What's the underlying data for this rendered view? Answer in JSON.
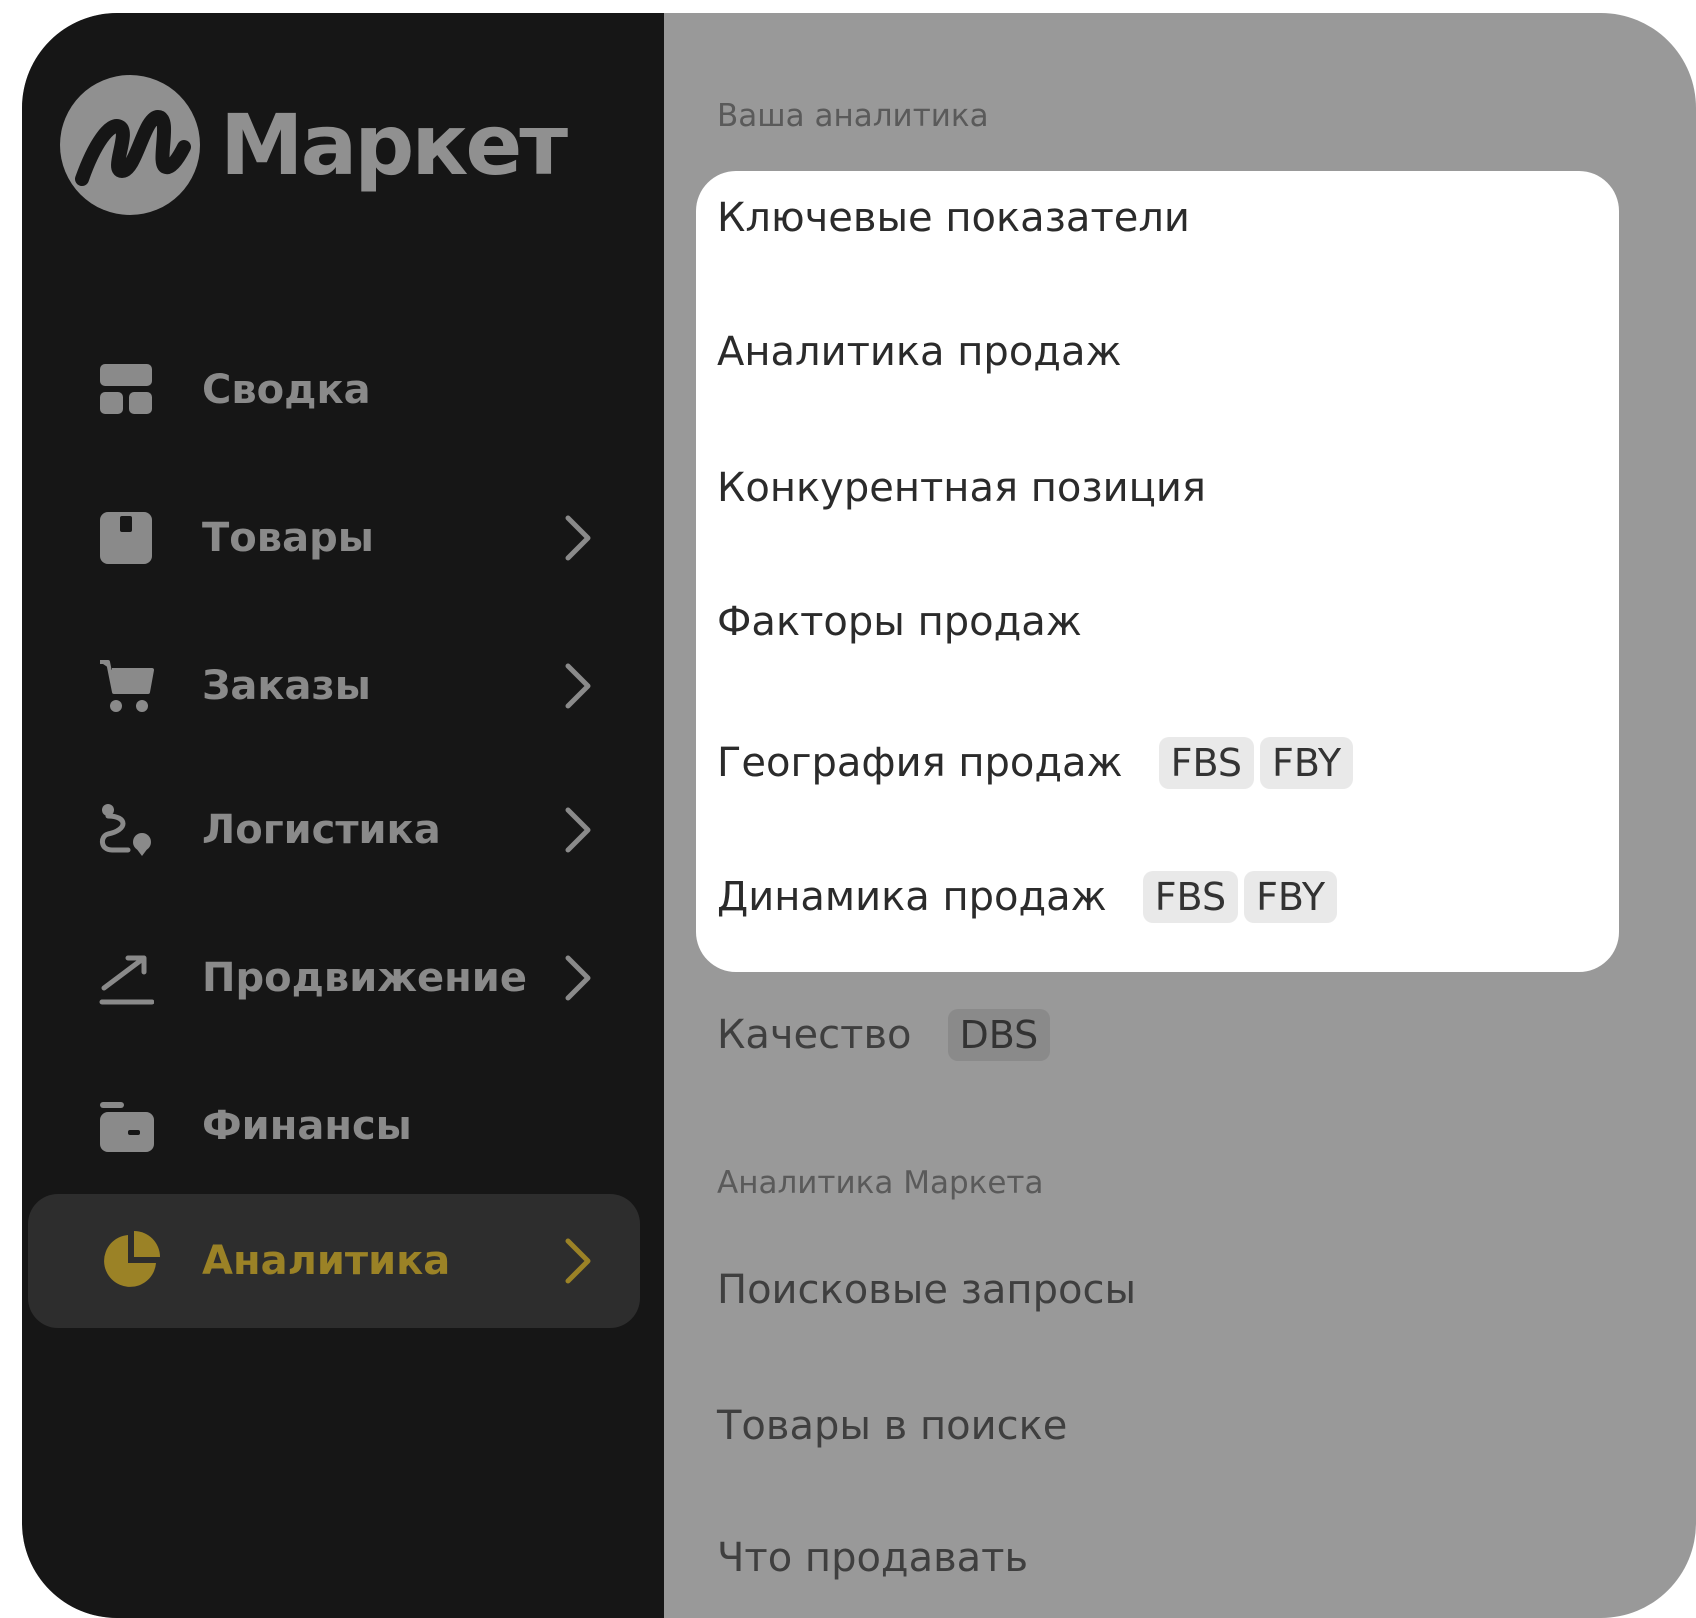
{
  "brand": {
    "name": "Маркет"
  },
  "sidebar": {
    "items": [
      {
        "label": "Сводка",
        "icon": "dashboard-icon",
        "has_chevron": false
      },
      {
        "label": "Товары",
        "icon": "box-icon",
        "has_chevron": true
      },
      {
        "label": "Заказы",
        "icon": "cart-icon",
        "has_chevron": true
      },
      {
        "label": "Логистика",
        "icon": "route-icon",
        "has_chevron": true
      },
      {
        "label": "Продвижение",
        "icon": "trend-up-icon",
        "has_chevron": true
      },
      {
        "label": "Финансы",
        "icon": "wallet-icon",
        "has_chevron": false
      },
      {
        "label": "Аналитика",
        "icon": "pie-chart-icon",
        "has_chevron": true,
        "active": true
      }
    ]
  },
  "submenu": {
    "section_your": "Ваша аналитика",
    "items": [
      {
        "label": "Ключевые показатели"
      },
      {
        "label": "Аналитика продаж"
      },
      {
        "label": "Конкурентная позиция"
      },
      {
        "label": "Факторы продаж"
      },
      {
        "label": "География продаж",
        "badges": [
          "FBS",
          "FBY"
        ]
      },
      {
        "label": "Динамика продаж",
        "badges": [
          "FBS",
          "FBY"
        ]
      }
    ],
    "quality": {
      "label": "Качество",
      "badge": "DBS"
    },
    "section_market": "Аналитика Маркета",
    "market_items": [
      {
        "label": "Поисковые запросы"
      },
      {
        "label": "Товары в поиске"
      },
      {
        "label": "Что продавать"
      }
    ]
  },
  "colors": {
    "sidebar_bg": "#161616",
    "overlay_bg": "#999999",
    "active_accent": "#9b8226",
    "card_bg": "#ffffff"
  }
}
